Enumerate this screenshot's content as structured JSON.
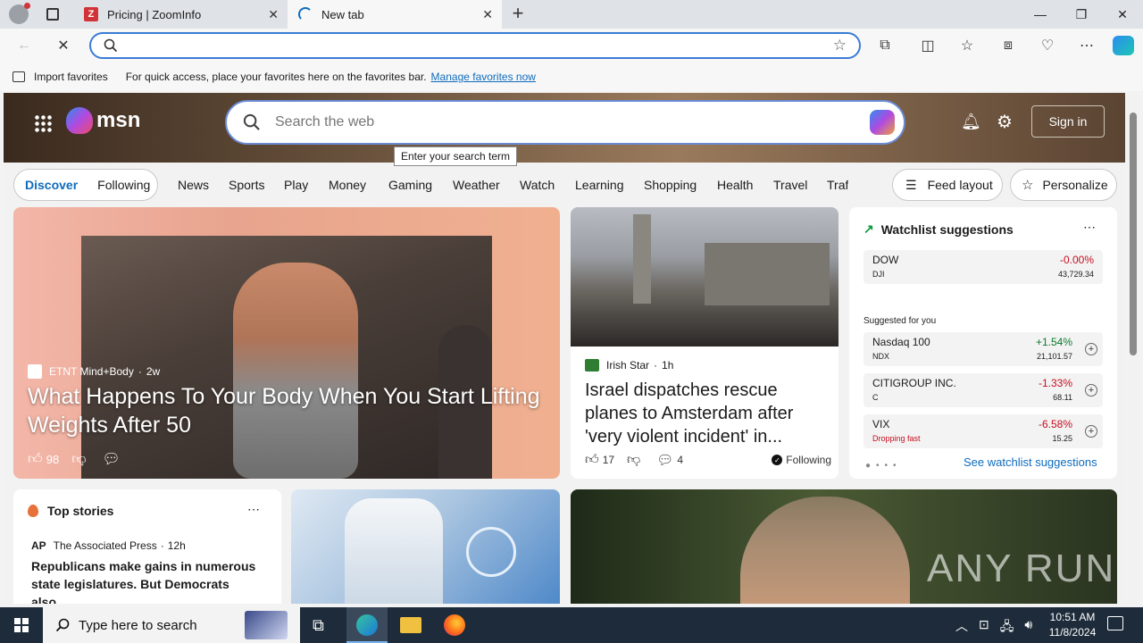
{
  "browser": {
    "tabs": [
      {
        "title": "Pricing | ZoomInfo",
        "favicon": "Z"
      },
      {
        "title": "New tab"
      }
    ],
    "new_tab": "+",
    "favorites_bar": {
      "import": "Import favorites",
      "hint": "For quick access, place your favorites here on the favorites bar.",
      "manage": "Manage favorites now"
    }
  },
  "msn": {
    "brand": "msn",
    "search_placeholder": "Search the web",
    "tooltip": "Enter your search term",
    "sign_in": "Sign in",
    "nav": {
      "discover": "Discover",
      "following": "Following",
      "items": [
        "News",
        "Sports",
        "Play",
        "Money",
        "Gaming",
        "Weather",
        "Watch",
        "Learning",
        "Shopping",
        "Health",
        "Travel",
        "Traf"
      ]
    },
    "feed_layout": "Feed layout",
    "personalize": "Personalize",
    "hero_story": {
      "source": "ETNT Mind+Body",
      "age": "2w",
      "title": "What Happens To Your Body When You Start Lifting Weights After 50",
      "likes": "98"
    },
    "story2": {
      "source": "Irish Star",
      "age": "1h",
      "title": "Israel dispatches rescue planes to Amsterdam after 'very violent incident' in...",
      "likes": "17",
      "comments": "4",
      "following": "Following"
    },
    "watchlist": {
      "title": "Watchlist suggestions",
      "dow": {
        "name": "DOW",
        "sym": "DJI",
        "chg": "-0.00%",
        "price": "43,729.34"
      },
      "suggested": "Suggested for you",
      "items": [
        {
          "name": "Nasdaq 100",
          "sym": "NDX",
          "chg": "+1.54%",
          "price": "21,101.57"
        },
        {
          "name": "CITIGROUP INC.",
          "sym": "C",
          "chg": "-1.33%",
          "price": "68.11"
        },
        {
          "name": "VIX",
          "sym": "Dropping fast",
          "chg": "-6.58%",
          "price": "15.25"
        }
      ],
      "see_more": "See watchlist suggestions"
    },
    "top_stories": {
      "title": "Top stories",
      "source": "The Associated Press",
      "age": "12h",
      "headline": "Republicans make gains in numerous state legislatures. But Democrats also..."
    }
  },
  "watermark": "ANY RUN",
  "taskbar": {
    "search": "Type here to search",
    "time": "10:51 AM",
    "date": "11/8/2024"
  },
  "colors": {
    "accent": "#0f6cbd",
    "positive": "#0c7a2a",
    "negative": "#c50f1f"
  }
}
